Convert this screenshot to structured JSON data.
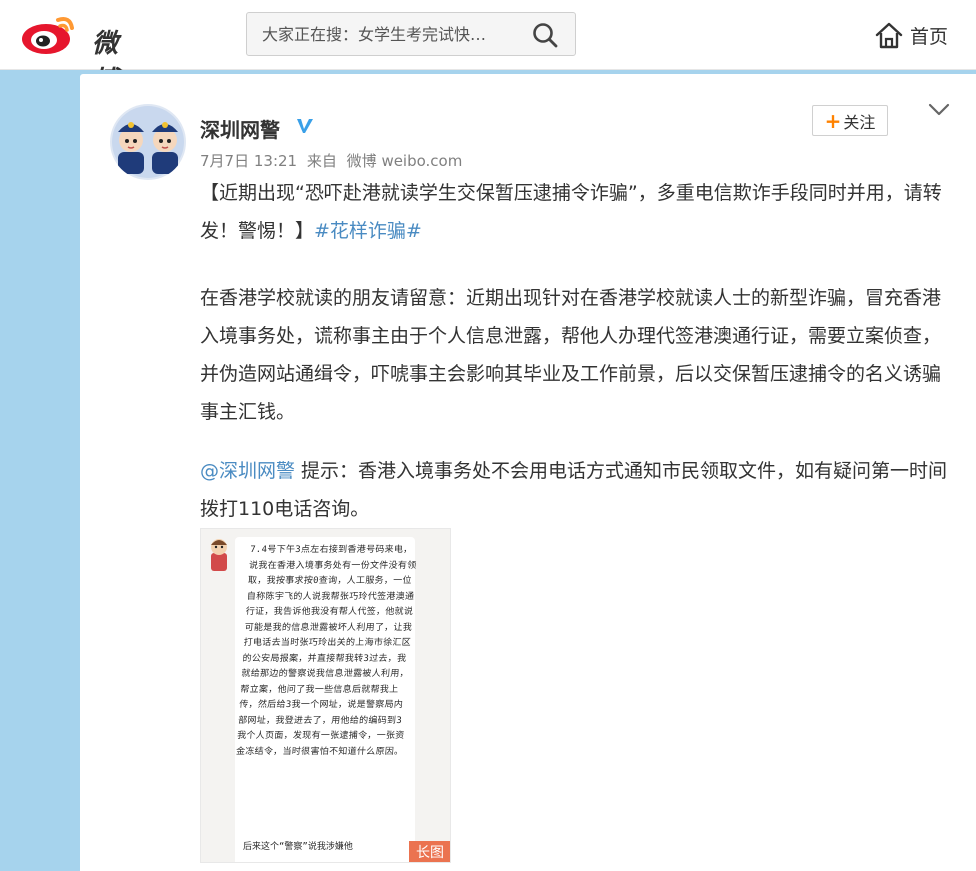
{
  "header": {
    "logo_text": "微博",
    "search_placeholder": "大家正在搜：女学生考完试快…",
    "home_label": "首页"
  },
  "post": {
    "author": "深圳网警",
    "follow_label": "关注",
    "meta": {
      "date": "7月7日 13:21",
      "from_label": "来自",
      "source": "微博 weibo.com"
    },
    "para1_text": "【近期出现“恐吓赴港就读学生交保暂压逮捕令诈骗”，多重电信欺诈手段同时并用，请转发！警惕！】",
    "para1_hashtag": "#花样诈骗#",
    "para2_text": "在香港学校就读的朋友请留意：近期出现针对在香港学校就读人士的新型诈骗，冒充香港入境事务处，谎称事主由于个人信息泄露，帮他人办理代签港澳通行证，需要立案侦查，并伪造网站通缉令，吓唬事主会影响其毕业及工作前景，后以交保暂压逮捕令的名义诱骗事主汇钱。",
    "para3_mention": "@深圳网警",
    "para3_text": " 提示：香港入境事务处不会用电话方式通知市民领取文件，如有疑问第一时间拨打110电话咨询。",
    "image": {
      "handwriting": "7.4号下午3点左右接到香港号码来电，说我在香港入境事务处有一份文件没有领取，我按事求按0查询，人工服务，一位自称陈宇飞的人说我帮张巧玲代签港澳通行证，我告诉他我没有帮人代签，他就说可能是我的信息泄露被坏人利用了，让我打电话去当时张巧玲出关的上海市徐汇区的公安局报案，并直接帮我转3过去，我就给那边的警察说我信息泄露被人利用，帮立案，他问了我一些信息后就帮我上传，然后给3我一个网址，说是警察局内部网址，我登进去了，用他给的编码到3我个人页面，发现有一张逮捕令，一张资金冻结令，当时很害怕不知道什么原因。",
      "handwriting_tail": "后来这个“警察”说我涉嫌他",
      "badge_label": "长图"
    }
  },
  "colors": {
    "background_blue": "#a6d3ed",
    "link": "#4a8bc2",
    "follow_plus": "#ff8200",
    "long_badge": "#eb7350",
    "verify_blue": "#3aa0e8"
  },
  "icons": {
    "logo": "weibo-logo-icon",
    "search": "search-icon",
    "home": "home-icon",
    "verify": "verified-v-icon",
    "more": "chevron-down-icon"
  }
}
